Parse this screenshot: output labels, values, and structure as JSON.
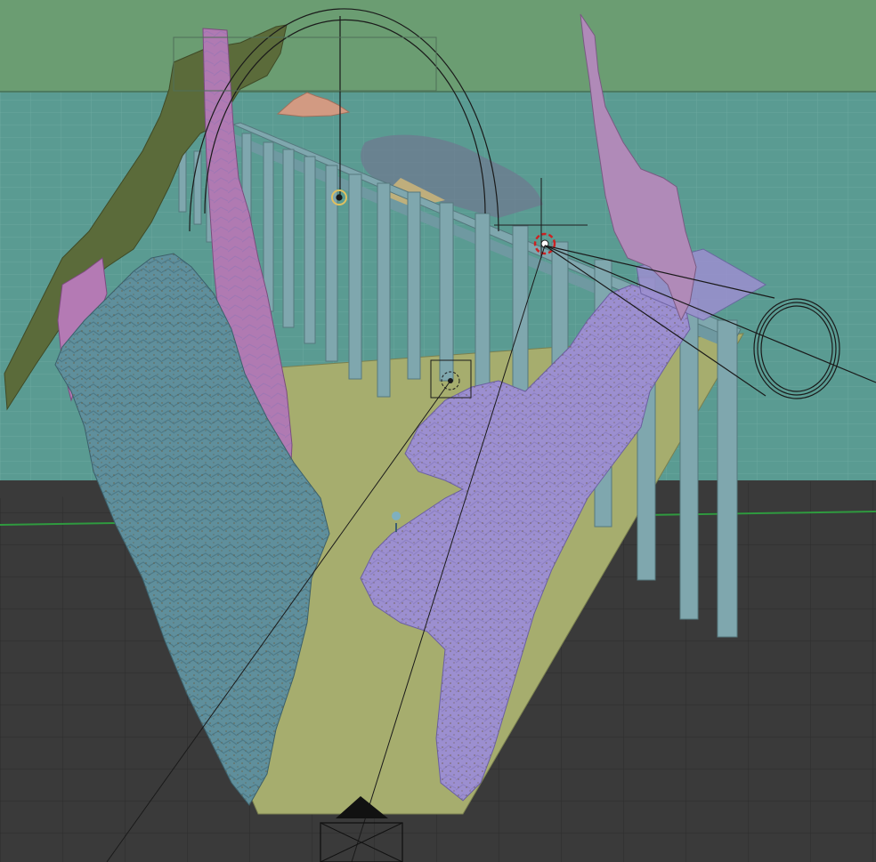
{
  "viewport": {
    "mode": "3d-viewport",
    "shading": "solid",
    "object_colors": "random"
  },
  "colors": {
    "sky": "#6b9d72",
    "world_horizon": "#4f8f86",
    "grid_floor_far": "#5a9b92",
    "grid_floor_near": "#3a3a3a",
    "ground_plane": "#a6ad6e",
    "viaduct": "#7fa7ae",
    "cliff_left": "#5f8f9c",
    "cliff_right": "#9c8fd0",
    "pillar_pink": "#b07ab2",
    "ridge_olive": "#5b6b3a",
    "cloud_plane": "#6f7890",
    "mountain_far": "#d29a82",
    "x_axis": "#2f9a3f",
    "camera_frame": "#111111",
    "light_gizmo": "#e0c060",
    "cursor": "#cc2222"
  },
  "objects": [
    {
      "name": "viaduct-bridge",
      "icon": "mesh-icon"
    },
    {
      "name": "cliff-left",
      "icon": "mesh-icon"
    },
    {
      "name": "cliff-right",
      "icon": "mesh-icon"
    },
    {
      "name": "rock-pillar",
      "icon": "mesh-icon"
    },
    {
      "name": "ridge-left",
      "icon": "mesh-icon"
    },
    {
      "name": "ground-plane",
      "icon": "mesh-icon"
    },
    {
      "name": "distant-mountain",
      "icon": "mesh-icon"
    },
    {
      "name": "cloud-plane",
      "icon": "mesh-icon"
    },
    {
      "name": "camera",
      "icon": "camera-icon"
    },
    {
      "name": "light-sun",
      "icon": "light-icon"
    },
    {
      "name": "light-area",
      "icon": "light-icon"
    },
    {
      "name": "spot-light",
      "icon": "light-icon"
    },
    {
      "name": "tree-sapling",
      "icon": "mesh-icon"
    }
  ]
}
